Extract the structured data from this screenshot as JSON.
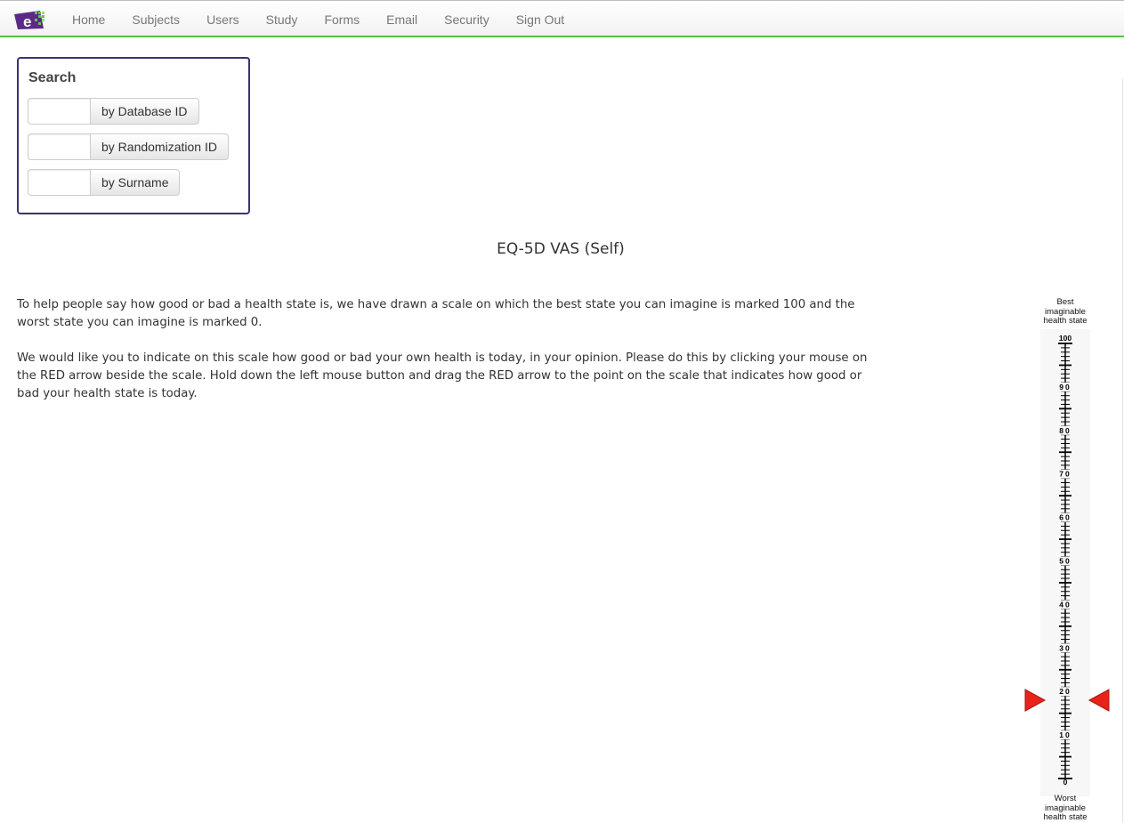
{
  "nav": {
    "logo": "logo-icon",
    "items": [
      "Home",
      "Subjects",
      "Users",
      "Study",
      "Forms",
      "Email",
      "Security",
      "Sign Out"
    ]
  },
  "search": {
    "title": "Search",
    "rows": [
      {
        "input_value": "",
        "button_label": "by Database ID"
      },
      {
        "input_value": "",
        "button_label": "by Randomization ID"
      },
      {
        "input_value": "",
        "button_label": "by Surname"
      }
    ]
  },
  "page": {
    "title": "EQ-5D VAS (Self)",
    "paragraphs": [
      "To help people say how good or bad a health state is, we have drawn a scale on which the best state you can imagine is marked 100 and the worst state you can imagine is marked 0.",
      "We would like you to indicate on this scale how good or bad your own health is today, in your opinion. Please do this by clicking your mouse on the RED arrow beside the scale. Hold down the left mouse button and drag the RED arrow to the point on the scale that indicates how good or bad your health state is today."
    ]
  },
  "vas": {
    "top_label": [
      "Best",
      "imaginable",
      "health state"
    ],
    "bottom_label": [
      "Worst",
      "imaginable",
      "health state"
    ],
    "max": 100,
    "min": 0,
    "labels": [
      "100",
      "90",
      "80",
      "70",
      "60",
      "50",
      "40",
      "30",
      "20",
      "10",
      "0"
    ],
    "value": 18,
    "arrow_color": "#e8231c"
  },
  "colors": {
    "nav_accent": "#5cbf3d",
    "search_border": "#3b3270",
    "logo_purple": "#5b2a86"
  }
}
